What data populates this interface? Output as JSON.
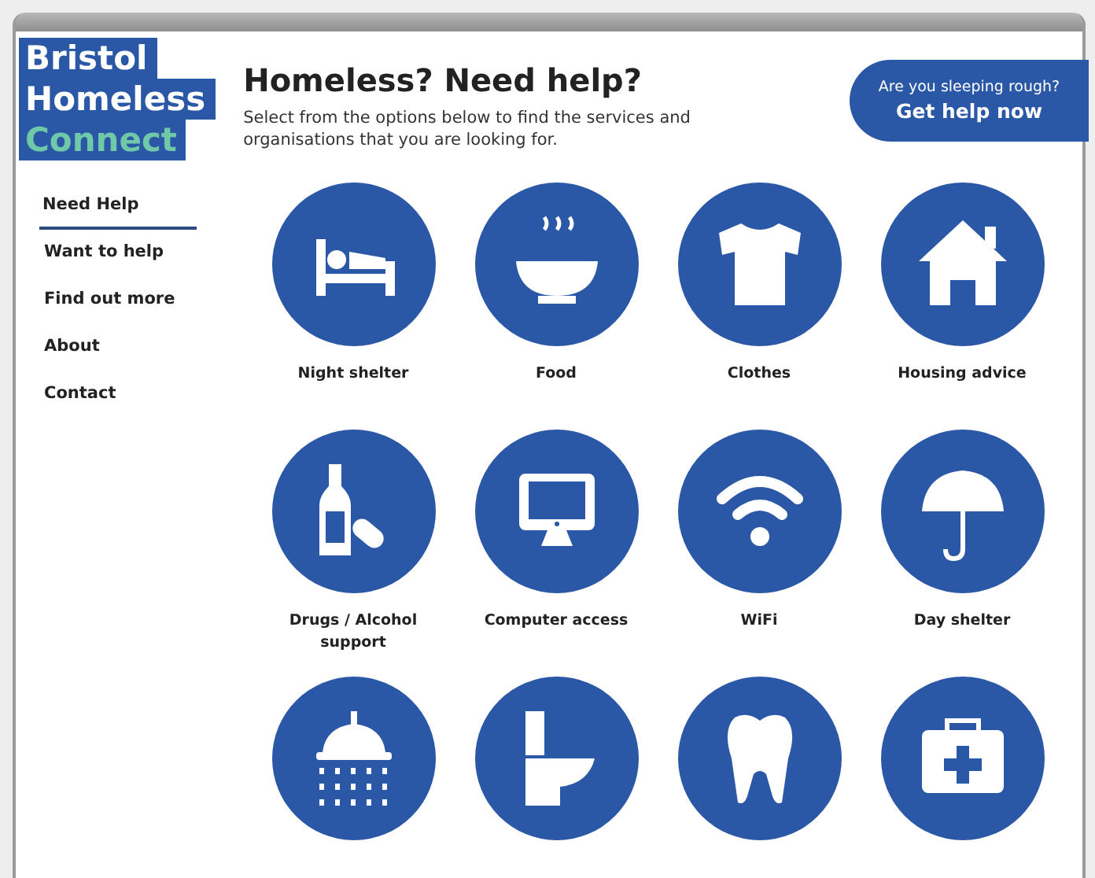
{
  "logo": {
    "lines": [
      "Bristol",
      "Homeless",
      "Connect"
    ]
  },
  "header": {
    "title": "Homeless? Need help?",
    "subtitle": "Select from the options below to find the services and organisations that you are looking for."
  },
  "cta": {
    "question": "Are you sleeping rough?",
    "action": "Get help now"
  },
  "nav": [
    {
      "label": "Need Help",
      "selected": true
    },
    {
      "label": "Want to help",
      "selected": false
    },
    {
      "label": "Find out more",
      "selected": false
    },
    {
      "label": "About",
      "selected": false
    },
    {
      "label": "Contact",
      "selected": false
    }
  ],
  "services": [
    {
      "label": "Night shelter"
    },
    {
      "label": "Food"
    },
    {
      "label": "Clothes"
    },
    {
      "label": "Housing advice"
    },
    {
      "label": "Drugs / Alcohol support"
    },
    {
      "label": "Computer access"
    },
    {
      "label": "WiFi"
    },
    {
      "label": "Day shelter"
    }
  ]
}
